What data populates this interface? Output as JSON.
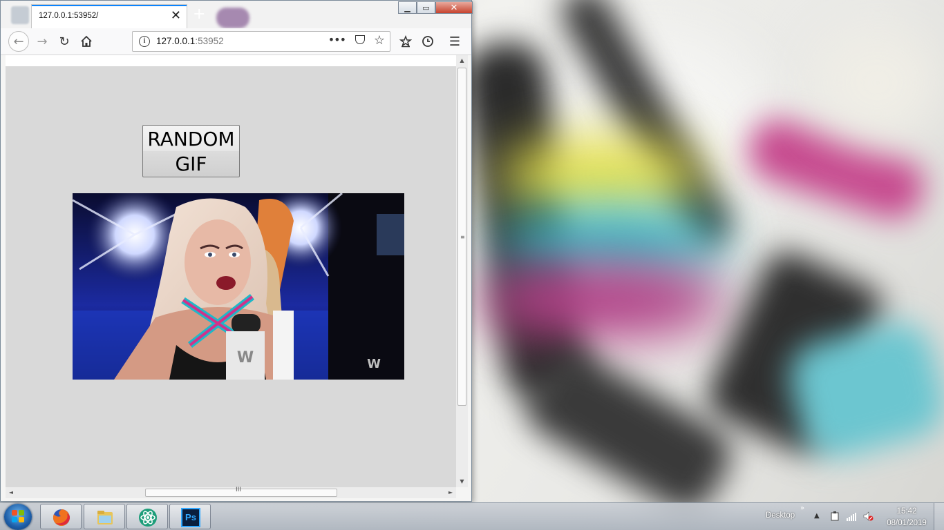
{
  "browser": {
    "tab_title": "127.0.0.1:53952/",
    "tab_close": "✕",
    "new_tab": "+",
    "url_host": "127.0.0.1",
    "url_port": ":53952",
    "url_more": "•••",
    "url_info": "i",
    "window_controls": {
      "minimize": "▁",
      "maximize": "▭",
      "close": "✕"
    }
  },
  "page": {
    "button_label": "RANDOM\nGIF",
    "gif_watermark": "W"
  },
  "scrollbars": {
    "grip": "≡",
    "hgrip": "III"
  },
  "taskbar": {
    "desktop_label": "Desktop",
    "desktop_chevron": "»",
    "tray_arrow": "▲",
    "time": "15:42",
    "date": "08/01/2019",
    "pinned": [
      {
        "name": "firefox-icon"
      },
      {
        "name": "file-explorer-icon"
      },
      {
        "name": "atom-icon"
      },
      {
        "name": "photoshop-icon",
        "label": "Ps"
      }
    ]
  },
  "colors": {
    "tab_accent": "#0a84ff",
    "content_bg": "#d9d9d9",
    "close_button": "#c7432e",
    "photoshop": "#0a1f3e"
  }
}
